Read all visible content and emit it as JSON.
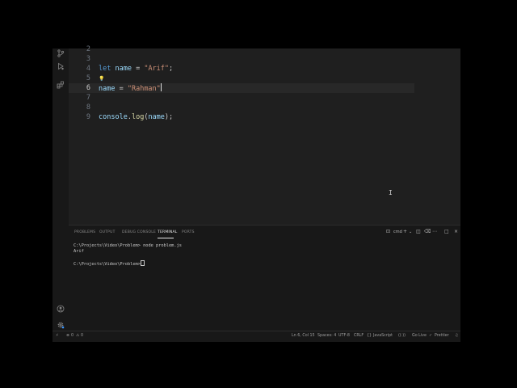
{
  "activity_bar": {
    "icons": [
      "source-control-icon",
      "run-debug-icon",
      "extensions-icon",
      "account-icon",
      "settings-gear-icon"
    ]
  },
  "editor": {
    "lines": [
      {
        "num": "2",
        "segments": []
      },
      {
        "num": "3",
        "segments": []
      },
      {
        "num": "4",
        "segments": [
          {
            "t": "let",
            "c": "kw"
          },
          {
            "t": " ",
            "c": "plain"
          },
          {
            "t": "name",
            "c": "var"
          },
          {
            "t": " = ",
            "c": "plain"
          },
          {
            "t": "\"Arif\"",
            "c": "str"
          },
          {
            "t": ";",
            "c": "plain"
          }
        ]
      },
      {
        "num": "5",
        "segments": []
      },
      {
        "num": "6",
        "segments": [
          {
            "t": "name",
            "c": "var"
          },
          {
            "t": " = ",
            "c": "plain"
          },
          {
            "t": "\"Rahman\"",
            "c": "str"
          }
        ]
      },
      {
        "num": "7",
        "segments": []
      },
      {
        "num": "8",
        "segments": []
      },
      {
        "num": "9",
        "segments": [
          {
            "t": "console",
            "c": "var"
          },
          {
            "t": ".",
            "c": "plain"
          },
          {
            "t": "log",
            "c": "fn"
          },
          {
            "t": "(",
            "c": "plain"
          },
          {
            "t": "name",
            "c": "var"
          },
          {
            "t": ");",
            "c": "plain"
          }
        ]
      }
    ],
    "lightbulb": "💡"
  },
  "panel": {
    "tabs": [
      "PROBLEMS",
      "OUTPUT",
      "DEBUG CONSOLE",
      "TERMINAL",
      "PORTS"
    ],
    "active_tab": "TERMINAL",
    "terminal_name": "cmd",
    "terminal_lines": [
      "C:\\Projects\\Video\\Problem> node problem.js",
      "Arif",
      "",
      "C:\\Projects\\Video\\Problem>"
    ]
  },
  "status_bar": {
    "remote": "⚡",
    "errors": "0",
    "warnings": "0",
    "position": "Ln 6, Col 15",
    "spaces": "Spaces: 4",
    "encoding": "UTF-8",
    "eol": "CRLF",
    "language": "JavaScript",
    "go_live": "Go Live",
    "prettier": "Prettier"
  }
}
